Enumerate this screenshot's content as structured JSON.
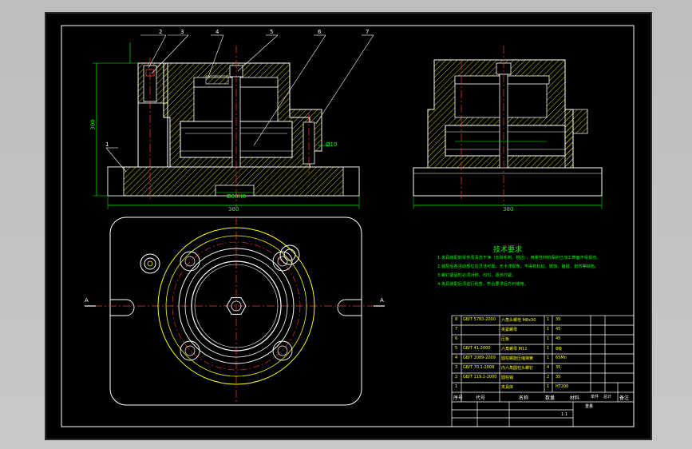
{
  "colors": {
    "background": "#c4c4c4",
    "sheet": "#000000",
    "outline": "#ffffff",
    "hatch": "#ffff00",
    "centerline": "#ff3333",
    "dimension": "#00ff00",
    "note_text": "#00ff00",
    "title_text": "#ffff00"
  },
  "balloons": [
    "2",
    "3",
    "4",
    "5",
    "6",
    "7",
    "1"
  ],
  "dims": {
    "height": "300",
    "width_left": "380",
    "width_right": "380",
    "bore": "Ø60H8",
    "pitch": "Ø10"
  },
  "section_marks": [
    "A",
    "A"
  ],
  "notes": {
    "title": "技术要求",
    "lines": [
      "1.夹具装配前零件须清洗干净（去除毛刺、锐边），用柔性材料保护已加工表面不受损伤。",
      "2.装配后各活动部位应灵活可靠，无卡滞现象，不得有松动、锈蚀、磕碰、划伤等缺陷。",
      "3.螺钉紧固时必须对称、均匀、逐步拧紧。",
      "4.夹具装配后须进行检查，符合要求后方可使用。"
    ]
  },
  "title_block": {
    "rows": [
      [
        "8",
        "GB/T 5783-2000",
        "六角头螺栓 M8x30",
        "1",
        "35"
      ],
      [
        "7",
        "",
        "夹紧螺母",
        "1",
        "45"
      ],
      [
        "6",
        "",
        "压板",
        "1",
        "45"
      ],
      [
        "5",
        "GB/T 41-2000",
        "六角螺母 M12",
        "1",
        "8级"
      ],
      [
        "4",
        "GB/T 2089-2009",
        "圆柱螺旋压缩弹簧",
        "1",
        "65Mn"
      ],
      [
        "3",
        "GB/T 70.1-2008",
        "内六角圆柱头螺钉",
        "4",
        "35"
      ],
      [
        "2",
        "GB/T 119.1-2000",
        "圆柱销",
        "2",
        "35"
      ],
      [
        "1",
        "",
        "夹具体",
        "1",
        "HT200"
      ]
    ],
    "headers": [
      "序号",
      "代号",
      "名称",
      "数量",
      "材料",
      "单件",
      "总计",
      "备注"
    ],
    "weight_label": "重量",
    "scale": "1:1"
  }
}
